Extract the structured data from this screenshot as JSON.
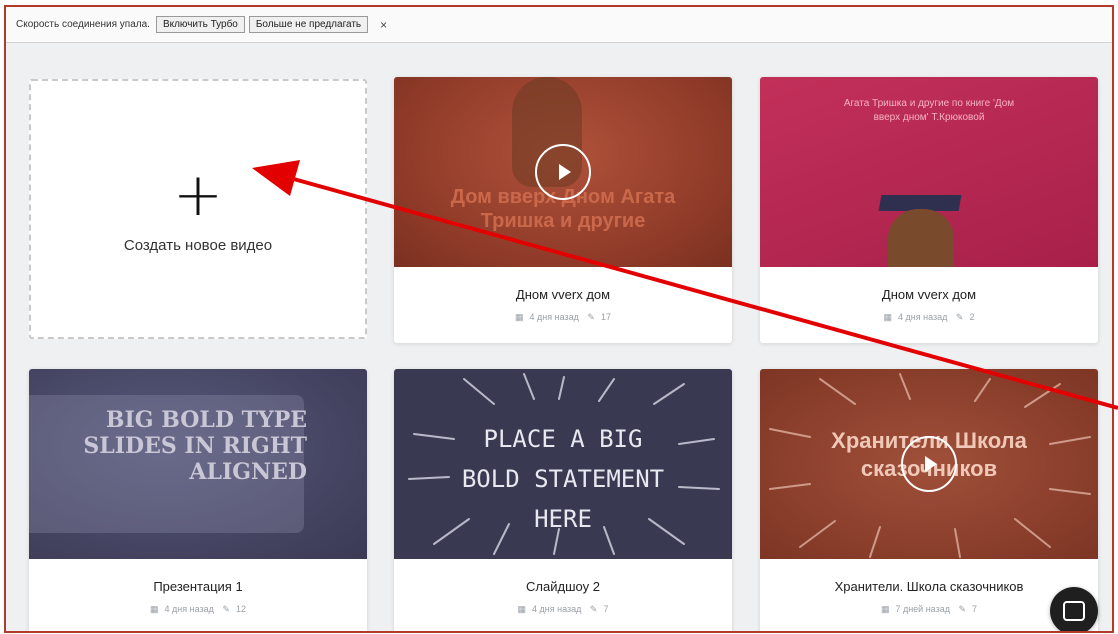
{
  "notification": {
    "message": "Скорость соединения упала.",
    "turbo_button": "Включить Турбо",
    "dismiss_button": "Больше не предлагать",
    "close": "×"
  },
  "create_card": {
    "plus": "+",
    "label": "Создать новое видео"
  },
  "videos": [
    {
      "title": "Днoм vverx дом",
      "date": "4 дня назад",
      "count": "17",
      "thumb_text": "Дом вверх Днoм Агата Тришка и другие"
    },
    {
      "title": "Днoм vverx дом",
      "date": "4 дня назад",
      "count": "2",
      "thumb_text": "Агата Тришка и другие по книге 'Дом вверх дном' Т.Крюковой"
    },
    {
      "title": "Презентация 1",
      "date": "4 дня назад",
      "count": "12",
      "thumb_text": "BIG BOLD TYPE SLIDES IN RIGHT ALIGNED"
    },
    {
      "title": "Слайдшоу 2",
      "date": "4 дня назад",
      "count": "7",
      "thumb_text": "PLACE A BIG BOLD STATEMENT HERE"
    },
    {
      "title": "Хранители. Школа сказочников",
      "date": "7 дней назад",
      "count": "7",
      "thumb_text": "Хранители Школа сказочников"
    }
  ],
  "colors": {
    "annotation_arrow": "#e30000",
    "frame_border": "#b33a2a"
  }
}
